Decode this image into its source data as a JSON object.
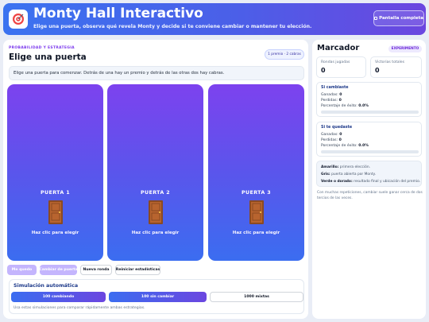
{
  "header": {
    "title": "Monty Hall Interactivo",
    "subtitle": "Elige una puerta, observa qué revela Monty y decide si te conviene cambiar o mantener tu elección.",
    "fullscreen_label": "Pantalla completa",
    "logo_icon": "target-icon"
  },
  "game": {
    "eyebrow": "PROBABILIDAD Y ESTRATEGIA",
    "title": "Elige una puerta",
    "prize_badge": "1 premio · 2 cabras",
    "instructions": "Elige una puerta para comenzar. Detrás de una hay un premio y detrás de las otras dos hay cabras.",
    "doors": [
      {
        "label": "PUERTA 1",
        "hint": "Haz clic para elegir"
      },
      {
        "label": "PUERTA 2",
        "hint": "Haz clic para elegir"
      },
      {
        "label": "PUERTA 3",
        "hint": "Haz clic para elegir"
      }
    ],
    "actions": {
      "stay": "Me quedo",
      "switch": "Cambiar de puerta",
      "new_round": "Nueva ronda",
      "reset": "Reiniciar estadísticas"
    }
  },
  "simulation": {
    "title": "Simulación automática",
    "buttons": [
      "100 cambiando",
      "100 sin cambiar",
      "1000 mixtas"
    ],
    "note": "Usa estas simulaciones para comparar rápidamente ambas estrategias."
  },
  "scoreboard": {
    "title": "Marcador",
    "badge": "EXPERIMENTO",
    "rounds_label": "Rondas jugadas",
    "rounds_value": "0",
    "wins_label": "Victorias totales",
    "wins_value": "0",
    "switch": {
      "title": "Si cambiaste",
      "won_label": "Ganadas:",
      "won_value": "0",
      "lost_label": "Perdidas:",
      "lost_value": "0",
      "rate_label": "Porcentaje de éxito:",
      "rate_value": "0.0%",
      "progress": 0
    },
    "stay": {
      "title": "Si te quedaste",
      "won_label": "Ganadas:",
      "won_value": "0",
      "lost_label": "Perdidas:",
      "lost_value": "0",
      "rate_label": "Porcentaje de éxito:",
      "rate_value": "0.0%",
      "progress": 0
    },
    "legend": [
      {
        "term": "Amarillo:",
        "text": "primera elección."
      },
      {
        "term": "Gris:",
        "text": "puerta abierta por Monty."
      },
      {
        "term": "Verde o dorado:",
        "text": "resultado final y ubicación del premio."
      }
    ],
    "note_lines": [
      "Con muchas repeticiones, cambiar suele ganar cerca de dos",
      "tercios de las veces."
    ]
  },
  "colors": {
    "header_gradient": [
      "#3b73f0",
      "#6b46e0"
    ],
    "door_gradient": [
      "#7d42ee",
      "#3b6df0"
    ],
    "accent": "#7c3aed"
  }
}
